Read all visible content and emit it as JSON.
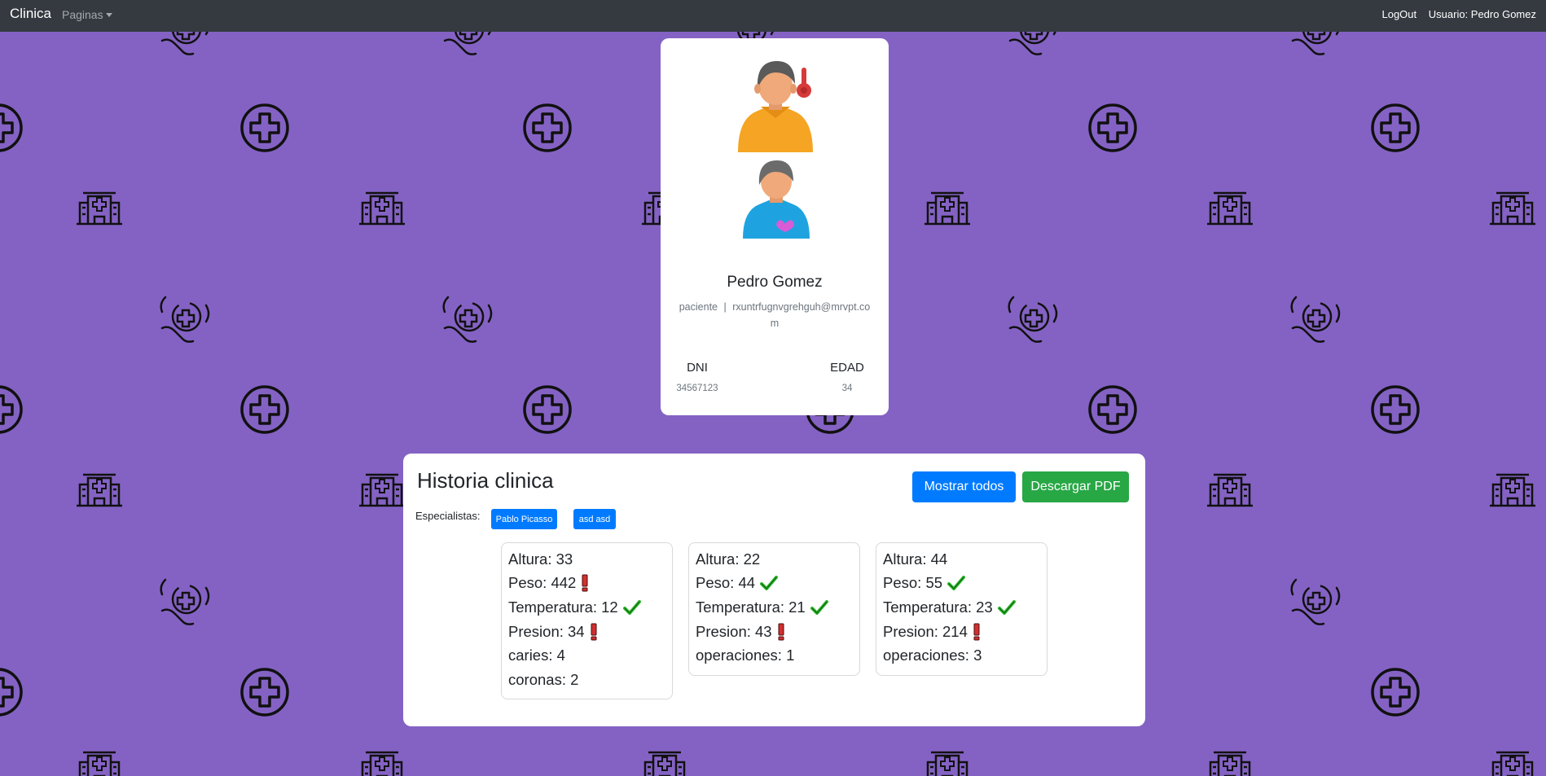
{
  "navbar": {
    "brand": "Clinica",
    "pages_menu": "Paginas",
    "logout": "LogOut",
    "user": "Usuario: Pedro Gomez"
  },
  "profile": {
    "name": "Pedro Gomez",
    "role": "paciente",
    "separator": "|",
    "email": "rxuntrfugnvgrehguh@mrvpt.com",
    "dni_label": "DNI",
    "dni_value": "34567123",
    "edad_label": "EDAD",
    "edad_value": "34"
  },
  "history": {
    "title": "Historia clinica",
    "show_all": "Mostrar todos",
    "download_pdf": "Descargar PDF",
    "specialists_label": "Especialistas:",
    "specialists": [
      "Pablo Picasso",
      "asd asd"
    ],
    "entries": [
      {
        "items": [
          {
            "text": "Altura: 33",
            "status": "none"
          },
          {
            "text": "Peso: 442",
            "status": "alert"
          },
          {
            "text": "Temperatura: 12",
            "status": "ok"
          },
          {
            "text": "Presion: 34",
            "status": "alert"
          },
          {
            "text": "caries: 4",
            "status": "none"
          },
          {
            "text": "coronas: 2",
            "status": "none"
          }
        ]
      },
      {
        "items": [
          {
            "text": "Altura: 22",
            "status": "none"
          },
          {
            "text": "Peso: 44",
            "status": "ok"
          },
          {
            "text": "Temperatura: 21",
            "status": "ok"
          },
          {
            "text": "Presion: 43",
            "status": "alert"
          },
          {
            "text": "operaciones: 1",
            "status": "none"
          }
        ]
      },
      {
        "items": [
          {
            "text": "Altura: 44",
            "status": "none"
          },
          {
            "text": "Peso: 55",
            "status": "ok"
          },
          {
            "text": "Temperatura: 23",
            "status": "ok"
          },
          {
            "text": "Presion: 214",
            "status": "alert"
          },
          {
            "text": "operaciones: 3",
            "status": "none"
          }
        ]
      }
    ]
  },
  "icons": {
    "background": [
      "hospital-building-icon",
      "medical-cross-circle-icon",
      "caring-hands-cross-icon"
    ],
    "status_ok": "check-icon",
    "status_alert": "exclamation-icon"
  },
  "colors": {
    "background": "#8462c4",
    "navbar": "#343a40",
    "primary": "#007bff",
    "success": "#28a745",
    "check": "#2cb52c",
    "alert": "#d32f2f"
  }
}
